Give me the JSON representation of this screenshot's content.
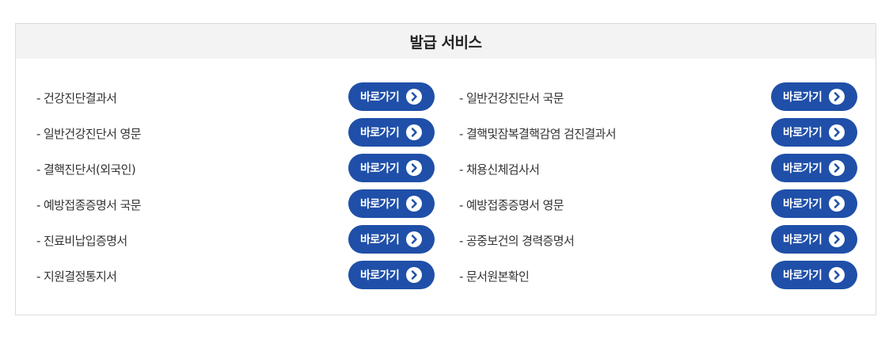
{
  "panel": {
    "title": "발급 서비스"
  },
  "items": [
    {
      "label": "-  건강진단결과서",
      "button": "바로가기"
    },
    {
      "label": "-  일반건강진단서 국문",
      "button": "바로가기"
    },
    {
      "label": "-  일반건강진단서 영문",
      "button": "바로가기"
    },
    {
      "label": "-  결핵및잠복결핵감염 검진결과서",
      "button": "바로가기"
    },
    {
      "label": "-  결핵진단서(외국인)",
      "button": "바로가기"
    },
    {
      "label": "-  채용신체검사서",
      "button": "바로가기"
    },
    {
      "label": "-  예방접종증명서 국문",
      "button": "바로가기"
    },
    {
      "label": "-  예방접종증명서 영문",
      "button": "바로가기"
    },
    {
      "label": "-  진료비납입증명서",
      "button": "바로가기"
    },
    {
      "label": "-  공중보건의 경력증명서",
      "button": "바로가기"
    },
    {
      "label": "-  지원결정통지서",
      "button": "바로가기"
    },
    {
      "label": "-  문서원본확인",
      "button": "바로가기"
    }
  ],
  "colors": {
    "button_bg": "#1f4fa8",
    "header_bg": "#f3f3f3"
  },
  "icons": {
    "button_icon": "chevron-right-circle-icon"
  }
}
